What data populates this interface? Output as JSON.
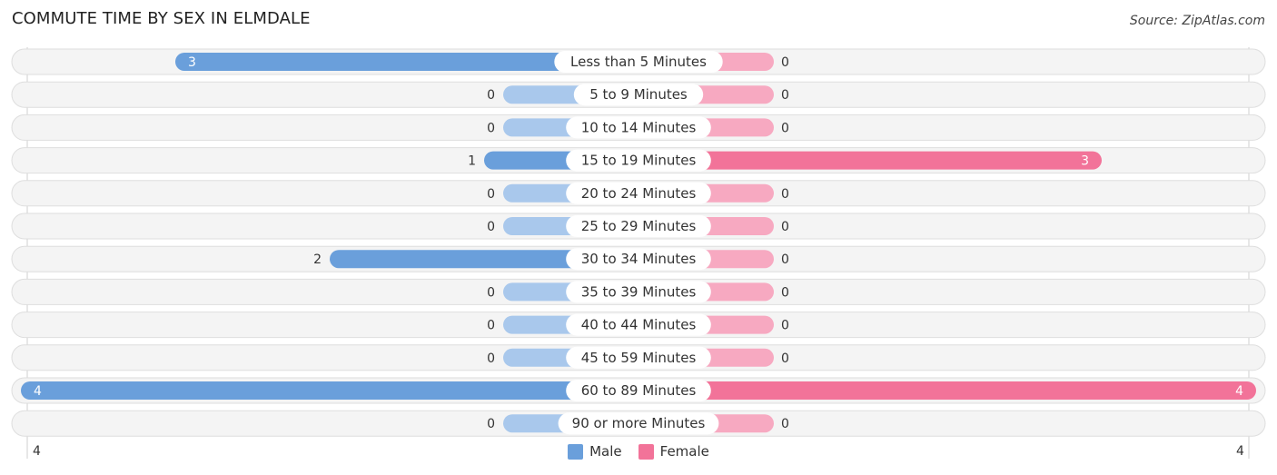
{
  "chart_data": {
    "type": "bar",
    "orientation": "horizontal-diverging",
    "title": "COMMUTE TIME BY SEX IN ELMDALE",
    "source": "Source: ZipAtlas.com",
    "categories": [
      "Less than 5 Minutes",
      "5 to 9 Minutes",
      "10 to 14 Minutes",
      "15 to 19 Minutes",
      "20 to 24 Minutes",
      "25 to 29 Minutes",
      "30 to 34 Minutes",
      "35 to 39 Minutes",
      "40 to 44 Minutes",
      "45 to 59 Minutes",
      "60 to 89 Minutes",
      "90 or more Minutes"
    ],
    "series": [
      {
        "name": "Male",
        "color": "#6a9fdb",
        "light_color": "#a9c8ec",
        "values": [
          3,
          0,
          0,
          1,
          0,
          0,
          2,
          0,
          0,
          0,
          4,
          0
        ]
      },
      {
        "name": "Female",
        "color": "#f27399",
        "light_color": "#f7a9c1",
        "values": [
          0,
          0,
          0,
          3,
          0,
          0,
          0,
          0,
          0,
          0,
          4,
          0
        ]
      }
    ],
    "xlim": [
      -4,
      4
    ],
    "axis_tick_labels": {
      "left": "4",
      "right": "4"
    },
    "legend": {
      "position": "bottom-center",
      "entries": [
        "Male",
        "Female"
      ]
    },
    "grid": false
  }
}
